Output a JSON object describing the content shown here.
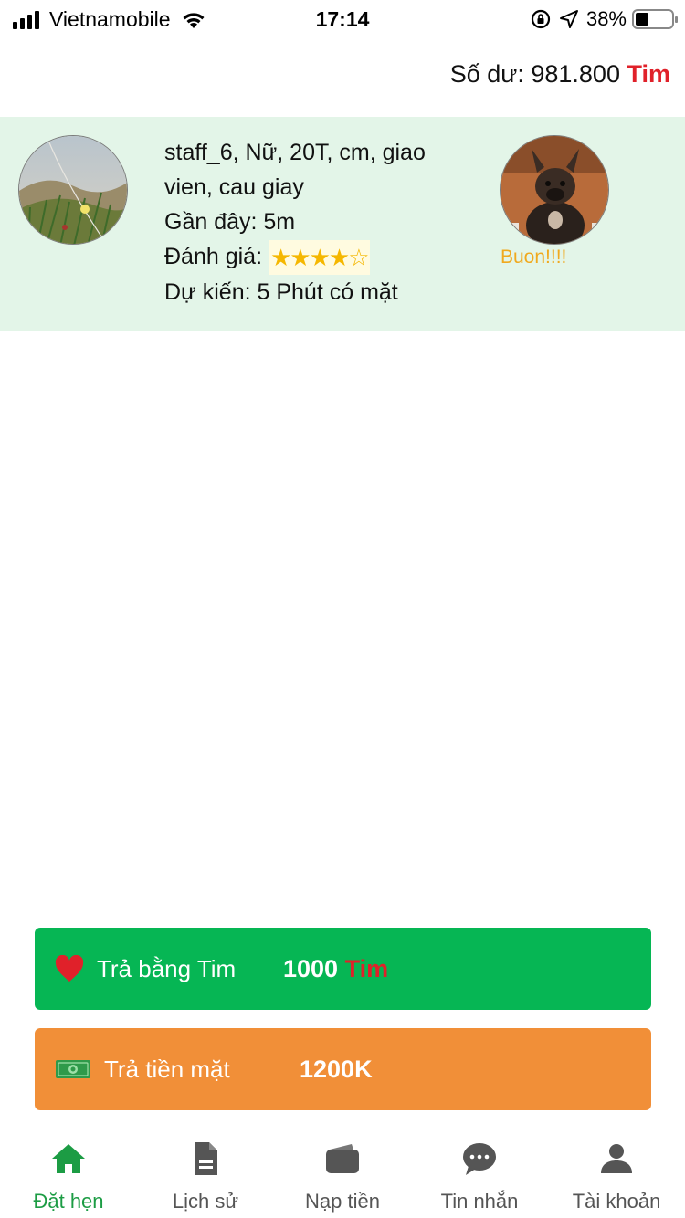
{
  "status_bar": {
    "carrier": "Vietnamobile",
    "time": "17:14",
    "battery": "38%"
  },
  "balance": {
    "label": "Số dư: 981.800",
    "currency": "Tim"
  },
  "staff": {
    "line1": "staff_6, Nữ, 20T, cm, giao",
    "line2": "vien, cau giay",
    "line3": "Gần đây: 5m",
    "rating_label": "Đánh giá:",
    "rating": 4,
    "rating_max": 5,
    "eta": "Dự kiến: 5 Phút có mặt",
    "mood": "Buon!!!!"
  },
  "actions": {
    "pay_tim": {
      "label": "Trả bằng Tim",
      "amount": "1000",
      "currency": "Tim"
    },
    "pay_cash": {
      "label": "Trả tiền mặt",
      "amount": "1200K"
    }
  },
  "tabs": [
    {
      "label": "Đặt hẹn",
      "icon": "home-icon",
      "active": true
    },
    {
      "label": "Lịch sử",
      "icon": "document-icon",
      "active": false
    },
    {
      "label": "Nạp tiền",
      "icon": "wallet-icon",
      "active": false
    },
    {
      "label": "Tin nhắn",
      "icon": "chat-icon",
      "active": false
    },
    {
      "label": "Tài khoản",
      "icon": "user-icon",
      "active": false
    }
  ],
  "colors": {
    "accent_green": "#06b654",
    "accent_orange": "#f18f38",
    "currency_red": "#e0212a",
    "card_bg": "#e3f5e8",
    "mood_text": "#f0a91e",
    "tab_active": "#1c9c44"
  }
}
